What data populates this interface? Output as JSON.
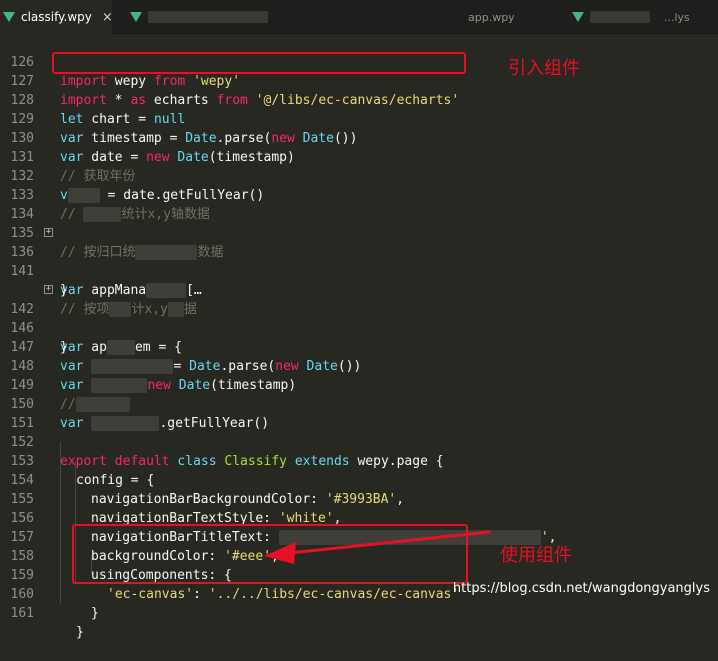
{
  "tabs": [
    {
      "name": "classify.wpy",
      "close": "×"
    },
    {
      "name": "app.wpy"
    },
    {
      "name": "...lys"
    }
  ],
  "lines": [
    {
      "n": "126"
    },
    {
      "n": "127"
    },
    {
      "n": "128"
    },
    {
      "n": "129"
    },
    {
      "n": "130"
    },
    {
      "n": "131"
    },
    {
      "n": "132"
    },
    {
      "n": "133"
    },
    {
      "n": "134"
    },
    {
      "n": "135"
    },
    {
      "n": "136"
    },
    {
      "n": "141"
    },
    {
      "n": "142"
    },
    {
      "n": "146"
    },
    {
      "n": "147"
    },
    {
      "n": "148"
    },
    {
      "n": "149"
    },
    {
      "n": "150"
    },
    {
      "n": "151"
    },
    {
      "n": "152"
    },
    {
      "n": "153"
    },
    {
      "n": "154"
    },
    {
      "n": "155"
    },
    {
      "n": "156"
    },
    {
      "n": "157"
    },
    {
      "n": "158"
    },
    {
      "n": "159"
    },
    {
      "n": "160"
    },
    {
      "n": "161"
    }
  ],
  "code": {
    "l126": {
      "a": "import",
      "b": " wepy ",
      "c": "from",
      "d": " 'wepy'"
    },
    "l127": {
      "a": "import",
      "b": " * ",
      "c": "as",
      "d": " echarts ",
      "e": "from",
      "f": " '@/libs/ec-canvas/echarts'"
    },
    "l128": {
      "a": "let",
      "b": " chart = ",
      "c": "null"
    },
    "l129": {
      "a": "var",
      "b": " timestamp = ",
      "c": "Date",
      "d": ".parse(",
      "e": "new",
      "f": " Date",
      "g": "())"
    },
    "l130": {
      "a": "var",
      "b": " date = ",
      "c": "new",
      "d": " Date",
      "e": "(timestamp)"
    },
    "l131": {
      "a": "// 获取年份"
    },
    "l132": {
      "a": "v",
      "b": " = date.getFullYear()"
    },
    "l133": {
      "a": "// ",
      "b": "统计x,y轴数据"
    },
    "l135": {
      "a": "// 按归口统",
      "b": "数据"
    },
    "l136": {
      "a": "var",
      "b": " appMana",
      "c": "[…"
    },
    "l141": {
      "a": "}"
    },
    "l142a": {
      "a": "// 按项",
      "b": "计x,y",
      "c": "据"
    },
    "l142": {
      "a": "var",
      "b": " ap",
      "c": "em = {"
    },
    "l146": {
      "a": "}"
    },
    "l147": {
      "a": "var",
      "b": "= ",
      "c": "Date",
      "d": ".parse(",
      "e": "new",
      "f": " Date",
      "g": "())"
    },
    "l148": {
      "a": "var",
      "b": "new",
      "c": " Date",
      "d": "(timestamp)"
    },
    "l149": {
      "a": "//"
    },
    "l150": {
      "a": "var",
      "b": ".getFullYear()"
    },
    "l152": {
      "a": "export",
      "b": " default ",
      "c": "class",
      "d": " Classify ",
      "e": "extends",
      "f": " wepy.page {"
    },
    "l153": {
      "a": "config = {"
    },
    "l154": {
      "a": "navigationBarBackgroundColor: ",
      "b": "'#3993BA'",
      "c": ","
    },
    "l155": {
      "a": "navigationBarTextStyle: ",
      "b": "'white'",
      "c": ","
    },
    "l156": {
      "a": "navigationBarTitleText: ",
      "b": "'",
      "c": ","
    },
    "l157": {
      "a": "backgroundColor: ",
      "b": "'#eee'",
      "c": ","
    },
    "l158": {
      "a": "usingComponents: {"
    },
    "l159": {
      "a": "'ec-canvas'",
      "b": ": ",
      "c": "'../../libs/ec-canvas/ec-canvas'"
    },
    "l160": {
      "a": "}"
    },
    "l161": {
      "a": "}"
    }
  },
  "annotations": {
    "import_note": "引入组件",
    "use_note": "使用组件",
    "color": "#e81123"
  },
  "watermark": "https://blog.csdn.net/wangdongyanglys",
  "icons": {
    "fold": "expand-plus-icon",
    "file": "vue-icon"
  }
}
